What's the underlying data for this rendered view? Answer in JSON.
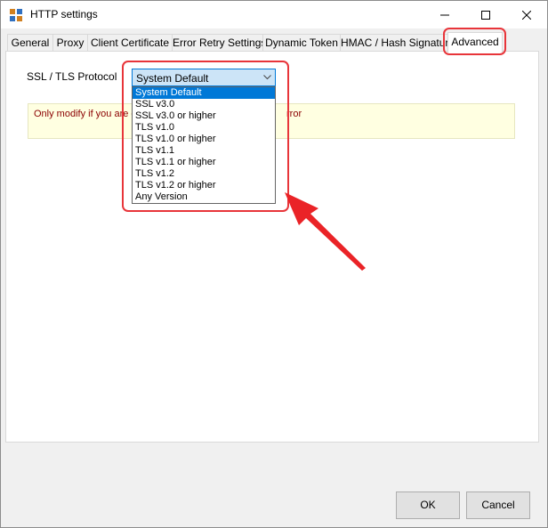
{
  "window": {
    "title": "HTTP settings"
  },
  "tabs": [
    {
      "label": "General"
    },
    {
      "label": "Proxy"
    },
    {
      "label": "Client Certificate"
    },
    {
      "label": "Error Retry Settings"
    },
    {
      "label": "Dynamic Token"
    },
    {
      "label": "HMAC / Hash Signature"
    },
    {
      "label": "Advanced"
    }
  ],
  "advanced": {
    "ssl_label": "SSL / TLS Protocol",
    "selected": "System Default",
    "options": [
      "System Default",
      "SSL v3.0",
      "SSL v3.0 or higher",
      "TLS v1.0",
      "TLS v1.0 or higher",
      "TLS v1.1",
      "TLS v1.1 or higher",
      "TLS v1.2",
      "TLS v1.2 or higher",
      "Any Version"
    ],
    "warning_left": "Only modify if you are ge",
    "warning_right": "rror"
  },
  "buttons": {
    "ok": "OK",
    "cancel": "Cancel"
  },
  "colors": {
    "accent": "#0078d7",
    "highlight": "#e8353a",
    "warning_bg": "#ffffe1",
    "warning_text": "#8b0000"
  }
}
